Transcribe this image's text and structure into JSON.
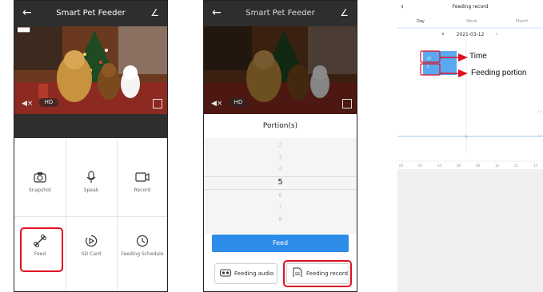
{
  "colors": {
    "accent": "#2d8ce8",
    "highlight": "#e01020",
    "topbar": "#2e2e2e",
    "chart_bar": "#5aa9f0"
  },
  "app": {
    "title": "Smart Pet Feeder",
    "back_icon": "arrow-left-icon",
    "edit_icon": "pencil-icon"
  },
  "video": {
    "hd_label": "HD"
  },
  "functions": [
    {
      "label": "Snapshot",
      "icon": "camera-icon"
    },
    {
      "label": "Speak",
      "icon": "microphone-icon"
    },
    {
      "label": "Record",
      "icon": "video-camera-icon"
    },
    {
      "label": "Feed",
      "icon": "bone-icon"
    },
    {
      "label": "SD Card",
      "icon": "sd-card-icon"
    },
    {
      "label": "Feeding Schedule",
      "icon": "clock-icon"
    }
  ],
  "portion": {
    "title": "Portion(s)",
    "options": [
      "2",
      "3",
      "4",
      "5",
      "6",
      "7",
      "8"
    ],
    "selected": "5",
    "feed_label": "Feed",
    "feeding_audio_label": "Feeding audio",
    "feeding_record_label": "Feeding record"
  },
  "record": {
    "title": "Feeding record",
    "tabs": [
      "Day",
      "Week",
      "Month"
    ],
    "date": "2021-03-12"
  },
  "chart_data": {
    "type": "bar",
    "x_ticks": [
      "00",
      "02",
      "04",
      "06",
      "08",
      "10",
      "12",
      "14"
    ],
    "bar_labels": {
      "time": "07",
      "portion": "5"
    },
    "y_ticks": [
      "3.0",
      "2.0"
    ]
  },
  "annotations": {
    "time": "Time",
    "portion": "Feeding portion"
  }
}
